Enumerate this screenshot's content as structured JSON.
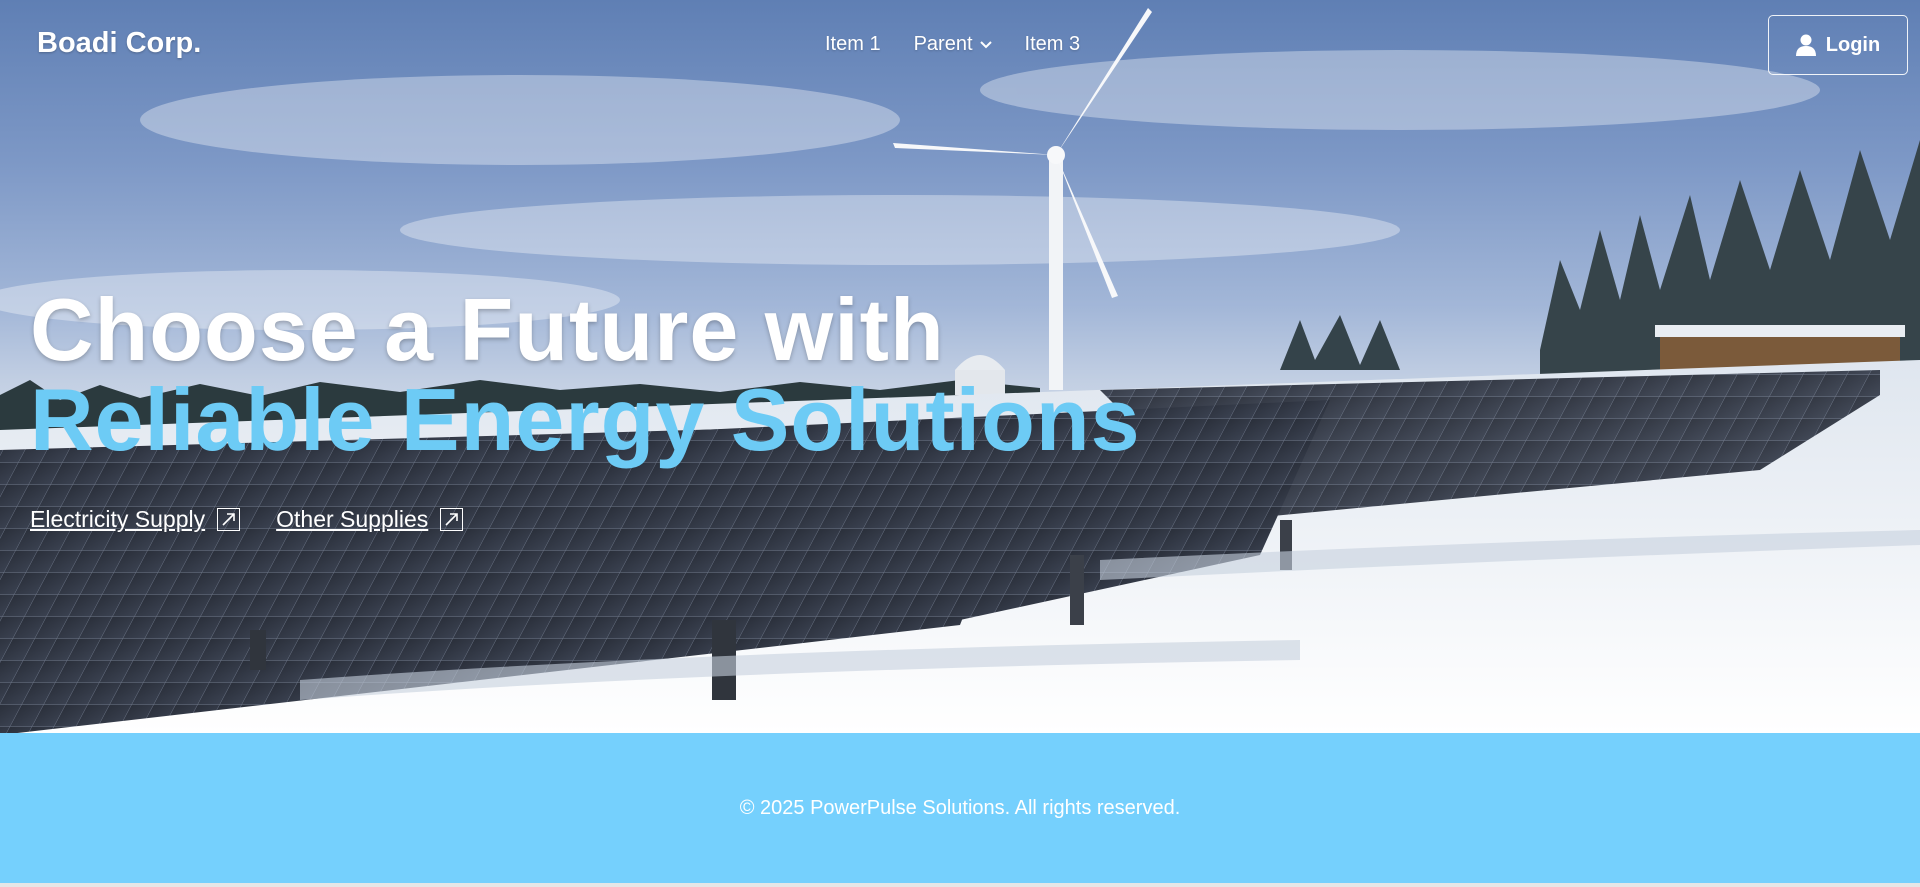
{
  "header": {
    "brand": "Boadi Corp.",
    "nav": [
      {
        "label": "Item 1"
      },
      {
        "label": "Parent",
        "has_dropdown": true
      },
      {
        "label": "Item 3"
      }
    ],
    "login_label": "Login"
  },
  "hero": {
    "title_line1": "Choose a Future with",
    "title_line2": "Reliable Energy Solutions",
    "links": [
      {
        "label": "Electricity Supply",
        "icon": "external-link-icon"
      },
      {
        "label": "Other Supplies",
        "icon": "external-link-icon"
      }
    ],
    "image": "snowy-solar-farm-with-wind-turbine",
    "accent_color": "#6dcbf5"
  },
  "footer": {
    "text": "© 2025 PowerPulse Solutions. All rights reserved.",
    "background": "#75d0fd"
  }
}
